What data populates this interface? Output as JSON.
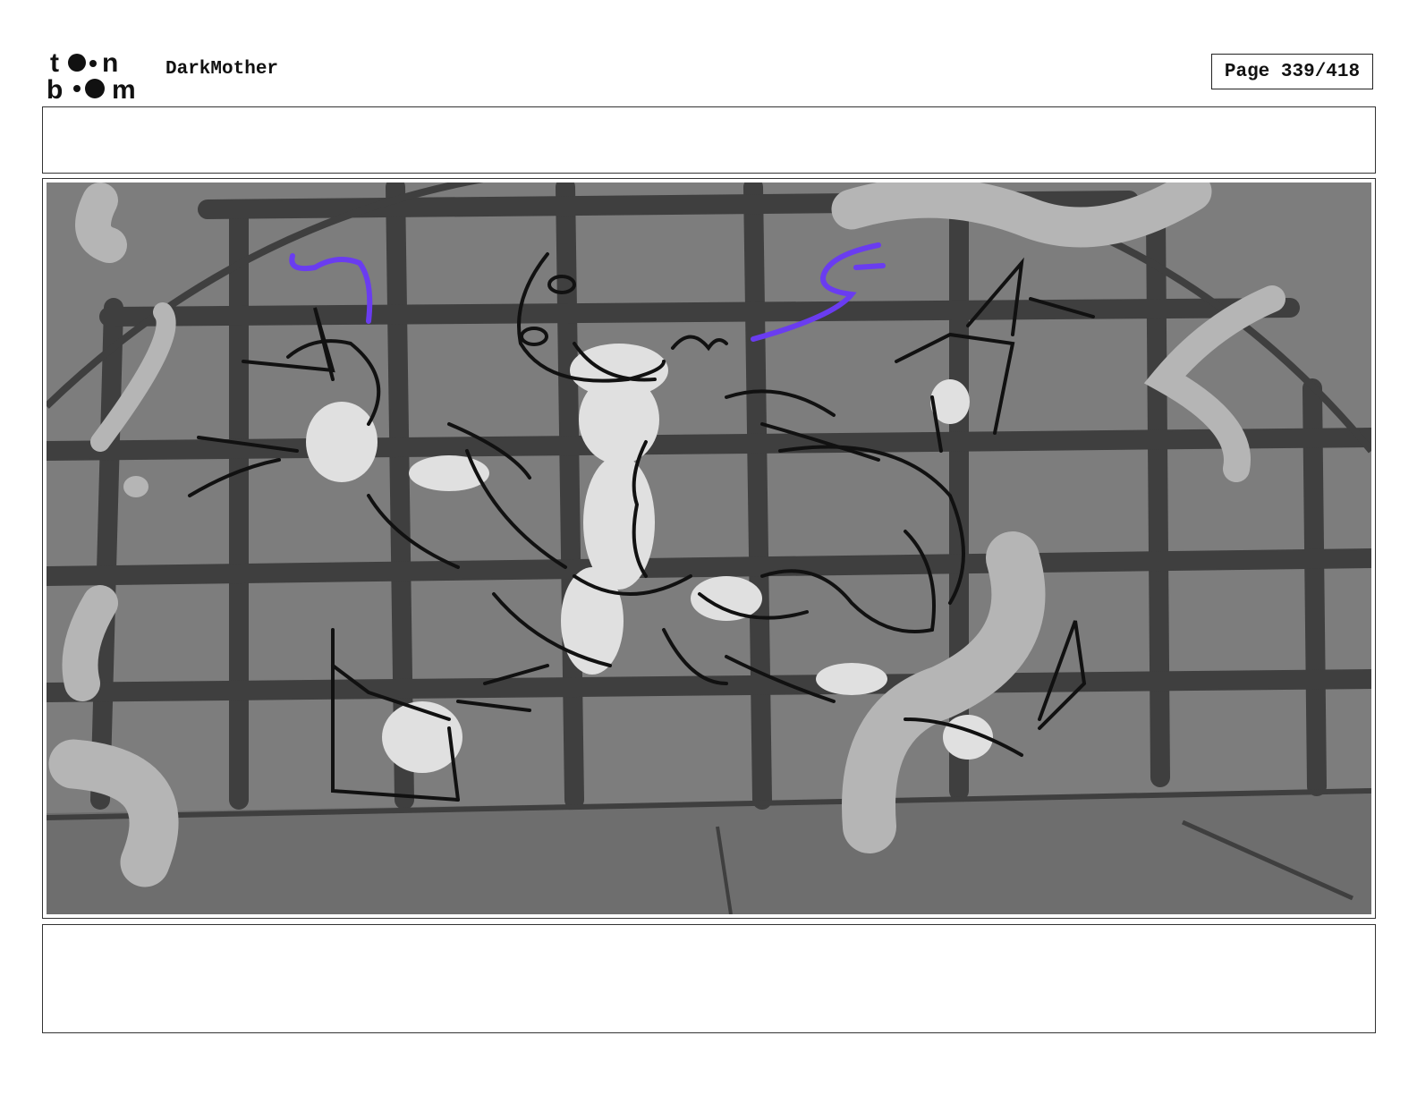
{
  "header": {
    "logo_icon": "toonboom-logo",
    "project_title": "DarkMother",
    "page_label": "Page 339/418"
  },
  "panel": {
    "background_color": "#7d7d7d",
    "grid_color": "#3f3f3f",
    "accent_color": "#6a3cf0"
  }
}
